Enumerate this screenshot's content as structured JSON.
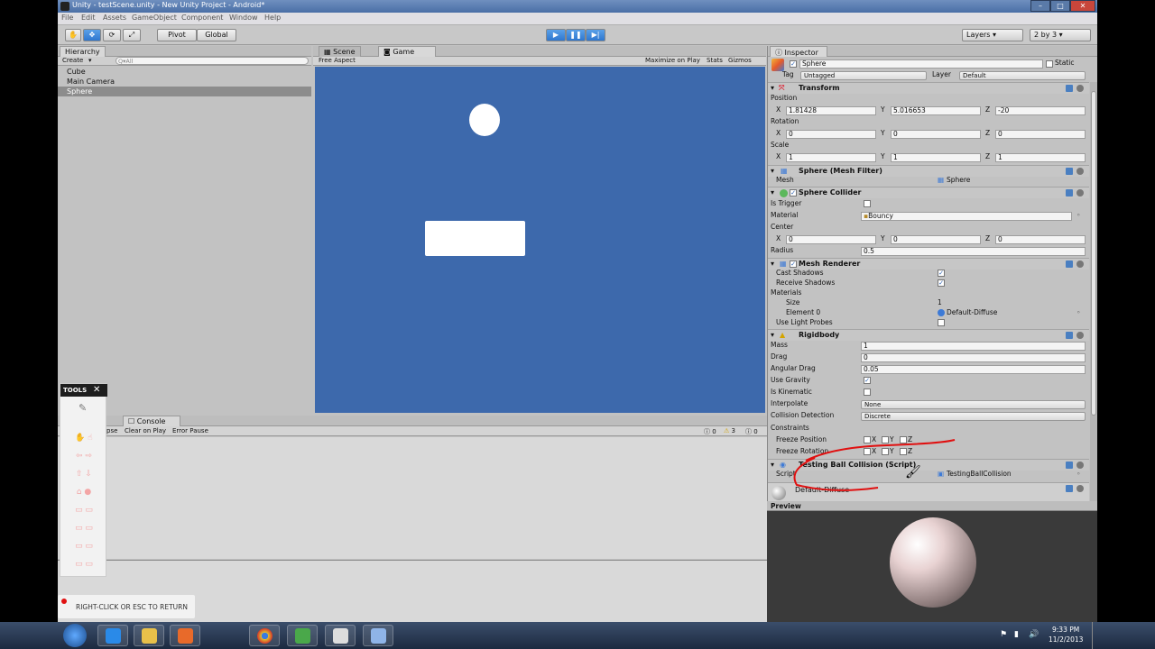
{
  "window": {
    "title": "Unity - testScene.unity - New Unity Project - Android*",
    "controls": [
      "–",
      "□",
      "✕"
    ]
  },
  "menu": [
    "File",
    "Edit",
    "Assets",
    "GameObject",
    "Component",
    "Window",
    "Help"
  ],
  "toolbar": {
    "pivot": "Pivot",
    "global": "Global",
    "layers": "Layers",
    "layout": "2 by 3"
  },
  "hierarchy": {
    "tab": "Hierarchy",
    "create": "Create",
    "search_placeholder": "Q▾All",
    "items": [
      "Cube",
      "Main Camera",
      "Sphere"
    ],
    "selected": "Sphere"
  },
  "scene_tabs": {
    "scene": "Scene",
    "game": "Game"
  },
  "game_bar": {
    "aspect": "Free Aspect",
    "maximize": "Maximize on Play",
    "stats": "Stats",
    "gizmos": "Gizmos"
  },
  "colors": {
    "game_bg": "#3d69ac",
    "selection": "#8c8c8c",
    "accent": "#3478d0"
  },
  "console": {
    "tab": "Console",
    "collapse": "pse",
    "clear_on_play": "Clear on Play",
    "error_pause": "Error Pause",
    "counts": [
      "0",
      "3",
      "0"
    ]
  },
  "tools_overlay": {
    "title": "TOOLS",
    "hint": "RIGHT-CLICK OR ESC TO RETURN"
  },
  "inspector": {
    "tab": "Inspector",
    "object_name": "Sphere",
    "static": "Static",
    "tag_label": "Tag",
    "tag": "Untagged",
    "layer_label": "Layer",
    "layer": "Default",
    "transform": {
      "title": "Transform",
      "position_label": "Position",
      "rotation_label": "Rotation",
      "scale_label": "Scale",
      "position": [
        "1.81428",
        "5.016653",
        "-20"
      ],
      "rotation": [
        "0",
        "0",
        "0"
      ],
      "scale": [
        "1",
        "1",
        "1"
      ],
      "axes": [
        "X",
        "Y",
        "Z"
      ]
    },
    "mesh_filter": {
      "title": "Sphere (Mesh Filter)",
      "mesh_label": "Mesh",
      "mesh": "Sphere"
    },
    "sphere_collider": {
      "title": "Sphere Collider",
      "is_trigger": "Is Trigger",
      "material_label": "Material",
      "material": "Bouncy",
      "center_label": "Center",
      "center": [
        "0",
        "0",
        "0"
      ],
      "radius_label": "Radius",
      "radius": "0.5"
    },
    "mesh_renderer": {
      "title": "Mesh Renderer",
      "cast_shadows": "Cast Shadows",
      "receive_shadows": "Receive Shadows",
      "materials": "Materials",
      "size_label": "Size",
      "size": "1",
      "element_label": "Element 0",
      "element": "Default-Diffuse",
      "light_probes": "Use Light Probes"
    },
    "rigidbody": {
      "title": "Rigidbody",
      "mass_label": "Mass",
      "mass": "1",
      "drag_label": "Drag",
      "drag": "0",
      "angular_label": "Angular Drag",
      "angular": "0.05",
      "gravity_label": "Use Gravity",
      "kinematic_label": "Is Kinematic",
      "interpolate_label": "Interpolate",
      "interpolate": "None",
      "collision_label": "Collision Detection",
      "collision": "Discrete",
      "constraints_label": "Constraints",
      "freeze_pos": "Freeze Position",
      "freeze_rot": "Freeze Rotation"
    },
    "script": {
      "title": "Testing Ball Collision (Script)",
      "script_label": "Script",
      "script": "TestingBallCollision"
    },
    "material_row": "Default-Diffuse",
    "preview": "Preview"
  },
  "taskbar": {
    "time": "9:33 PM",
    "date": "11/2/2013"
  }
}
